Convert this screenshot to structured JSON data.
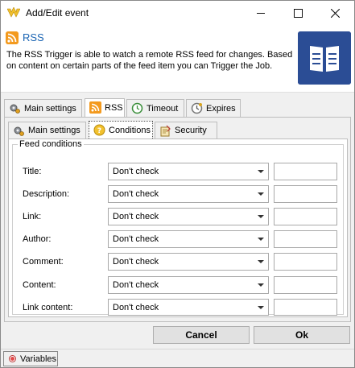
{
  "window": {
    "title": "Add/Edit event"
  },
  "header": {
    "title": "RSS",
    "description": "The RSS Trigger is able to watch a remote RSS feed for changes. Based on content on certain parts of the feed item you can Trigger the Job."
  },
  "outer_tabs": [
    {
      "label": "Main settings",
      "icon": "gear-icon"
    },
    {
      "label": "RSS",
      "icon": "rss-icon",
      "active": true
    },
    {
      "label": "Timeout",
      "icon": "timeout-icon"
    },
    {
      "label": "Expires",
      "icon": "expires-icon"
    }
  ],
  "inner_tabs": [
    {
      "label": "Main settings",
      "icon": "gear-icon"
    },
    {
      "label": "Conditions",
      "icon": "conditions-icon",
      "active": true
    },
    {
      "label": "Security",
      "icon": "security-icon"
    }
  ],
  "group": {
    "legend": "Feed conditions"
  },
  "conditions": [
    {
      "label": "Title:",
      "value": "Don't check",
      "text": ""
    },
    {
      "label": "Description:",
      "value": "Don't check",
      "text": ""
    },
    {
      "label": "Link:",
      "value": "Don't check",
      "text": ""
    },
    {
      "label": "Author:",
      "value": "Don't check",
      "text": ""
    },
    {
      "label": "Comment:",
      "value": "Don't check",
      "text": ""
    },
    {
      "label": "Content:",
      "value": "Don't check",
      "text": ""
    },
    {
      "label": "Link content:",
      "value": "Don't check",
      "text": ""
    }
  ],
  "buttons": {
    "cancel": "Cancel",
    "ok": "Ok"
  },
  "statusbar": {
    "variables": "Variables"
  },
  "colors": {
    "accent": "#1a64b3",
    "rss": "#f39a1e",
    "big_icon": "#2b4d95"
  }
}
